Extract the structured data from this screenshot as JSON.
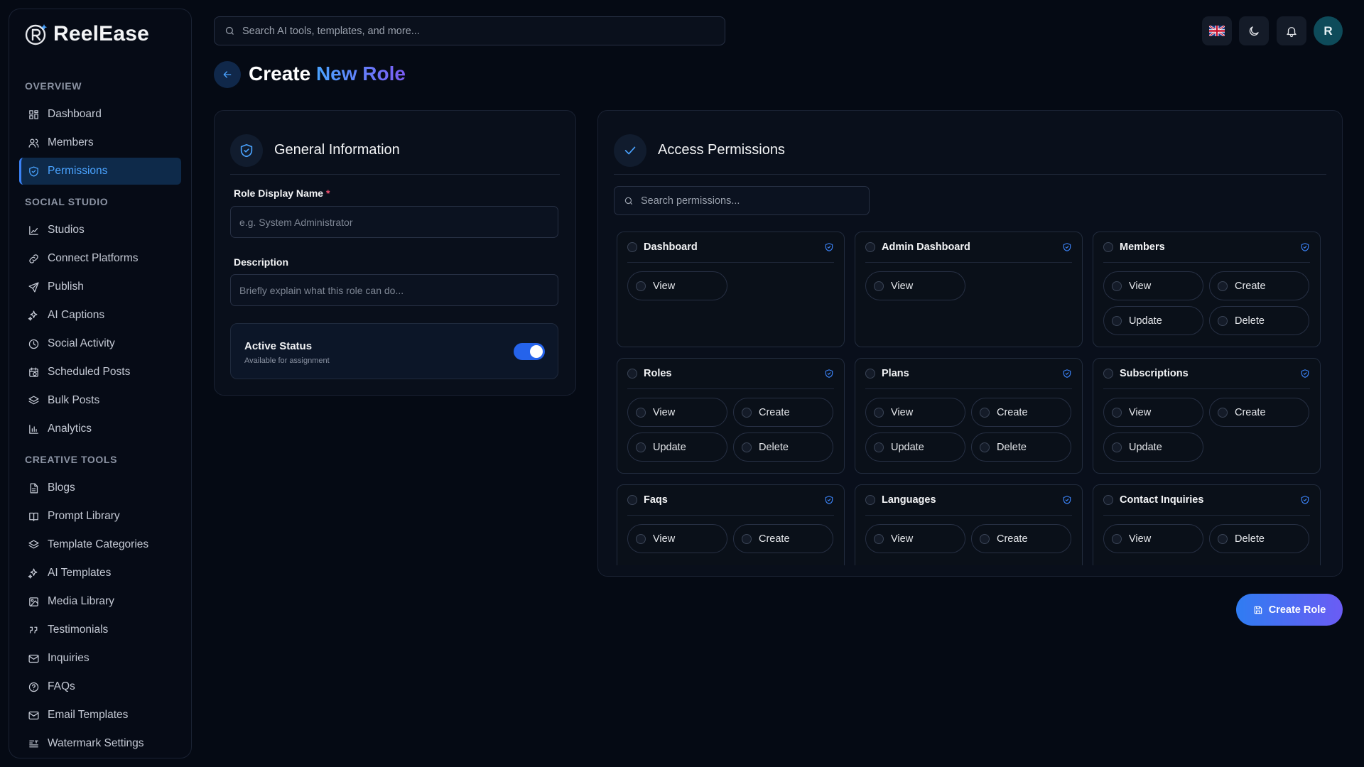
{
  "app": {
    "name": "ReelEase"
  },
  "sidebar": {
    "sections": [
      {
        "title": "OVERVIEW",
        "items": [
          {
            "label": "Dashboard",
            "icon": "dashboard-icon"
          },
          {
            "label": "Members",
            "icon": "users-icon"
          },
          {
            "label": "Permissions",
            "icon": "shield-icon",
            "active": true
          }
        ]
      },
      {
        "title": "SOCIAL STUDIO",
        "items": [
          {
            "label": "Studios",
            "icon": "chart-icon"
          },
          {
            "label": "Connect Platforms",
            "icon": "link-icon"
          },
          {
            "label": "Publish",
            "icon": "send-icon"
          },
          {
            "label": "AI Captions",
            "icon": "sparkles-icon"
          },
          {
            "label": "Social Activity",
            "icon": "clock-icon"
          },
          {
            "label": "Scheduled Posts",
            "icon": "calendar-clock-icon"
          },
          {
            "label": "Bulk Posts",
            "icon": "layers-icon"
          },
          {
            "label": "Analytics",
            "icon": "bar-chart-icon"
          }
        ]
      },
      {
        "title": "CREATIVE TOOLS",
        "items": [
          {
            "label": "Blogs",
            "icon": "file-icon"
          },
          {
            "label": "Prompt Library",
            "icon": "book-icon"
          },
          {
            "label": "Template Categories",
            "icon": "layers-icon"
          },
          {
            "label": "AI Templates",
            "icon": "sparkles-icon"
          },
          {
            "label": "Media Library",
            "icon": "image-icon"
          },
          {
            "label": "Testimonials",
            "icon": "quote-icon"
          },
          {
            "label": "Inquiries",
            "icon": "mail-icon"
          },
          {
            "label": "FAQs",
            "icon": "help-icon"
          },
          {
            "label": "Email Templates",
            "icon": "mail-icon"
          },
          {
            "label": "Watermark Settings",
            "icon": "text-icon"
          }
        ]
      }
    ]
  },
  "topbar": {
    "search_placeholder": "Search AI tools, templates, and more...",
    "avatar_initial": "R"
  },
  "page": {
    "title_prefix": "Create",
    "title_accent": "New Role"
  },
  "general": {
    "title": "General Information",
    "role_name_label": "Role Display Name",
    "required_mark": "*",
    "role_name_placeholder": "e.g. System Administrator",
    "description_label": "Description",
    "description_placeholder": "Briefly explain what this role can do...",
    "status_title": "Active Status",
    "status_subtitle": "Available for assignment",
    "status_on": true
  },
  "permissions": {
    "title": "Access Permissions",
    "search_placeholder": "Search permissions...",
    "groups": [
      {
        "name": "Dashboard",
        "actions": [
          "View"
        ]
      },
      {
        "name": "Admin Dashboard",
        "actions": [
          "View"
        ]
      },
      {
        "name": "Members",
        "actions": [
          "View",
          "Create",
          "Update",
          "Delete"
        ]
      },
      {
        "name": "Roles",
        "actions": [
          "View",
          "Create",
          "Update",
          "Delete"
        ]
      },
      {
        "name": "Plans",
        "actions": [
          "View",
          "Create",
          "Update",
          "Delete"
        ]
      },
      {
        "name": "Subscriptions",
        "actions": [
          "View",
          "Create",
          "Update"
        ]
      },
      {
        "name": "Faqs",
        "actions": [
          "View",
          "Create"
        ]
      },
      {
        "name": "Languages",
        "actions": [
          "View",
          "Create"
        ]
      },
      {
        "name": "Contact Inquiries",
        "actions": [
          "View",
          "Delete"
        ]
      }
    ]
  },
  "footer": {
    "create_label": "Create Role"
  },
  "colors": {
    "accent": "#3b82f6",
    "accent_violet": "#7c5cf4",
    "background": "#050a14"
  }
}
